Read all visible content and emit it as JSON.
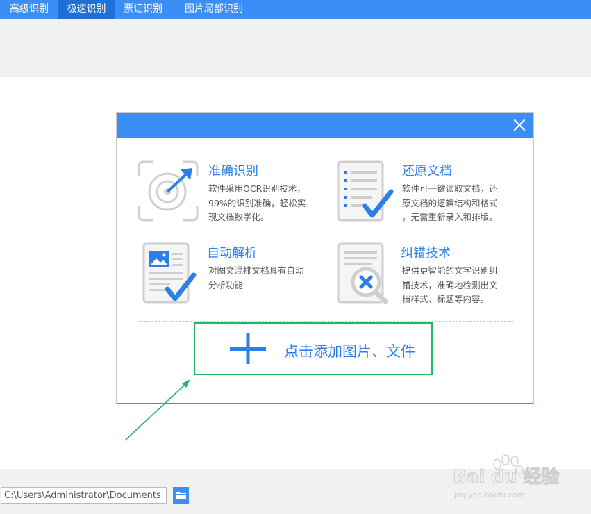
{
  "tabs": [
    {
      "label": "高级识别",
      "active": false
    },
    {
      "label": "极速识别",
      "active": true
    },
    {
      "label": "票证识别",
      "active": false
    },
    {
      "label": "图片局部识别",
      "active": false
    }
  ],
  "dialog": {
    "close_icon": "close-icon",
    "features": [
      {
        "title": "准确识别",
        "desc": "软件采用OCR识别技术，\n99%的识别准确，轻松实\n现文档数字化。",
        "icon": "target-icon"
      },
      {
        "title": "还原文档",
        "desc": "软件可一键读取文档，还\n原文档的逻辑结构和格式\n，无需重新录入和排版。",
        "icon": "document-check-icon"
      },
      {
        "title": "自动解析",
        "desc": "对图文混排文档具有自动\n分析功能",
        "icon": "image-document-check-icon"
      },
      {
        "title": "纠错技术",
        "desc": "提供更智能的文字识别纠\n错技术，准确地检测出文\n档样式、标题等内容。",
        "icon": "document-magnifier-icon"
      }
    ],
    "add_label": "点击添加图片、文件"
  },
  "bottom": {
    "path_value": "C:\\Users\\Administrator\\Documents",
    "folder_icon": "folder-icon"
  },
  "watermark": {
    "brand": "Bai du 经验",
    "url": "jingyan.baidu.com"
  },
  "colors": {
    "accent": "#3a8ef5",
    "active_tab": "#1e6fd8",
    "highlight": "#1fb868",
    "title": "#2b7fe8"
  }
}
